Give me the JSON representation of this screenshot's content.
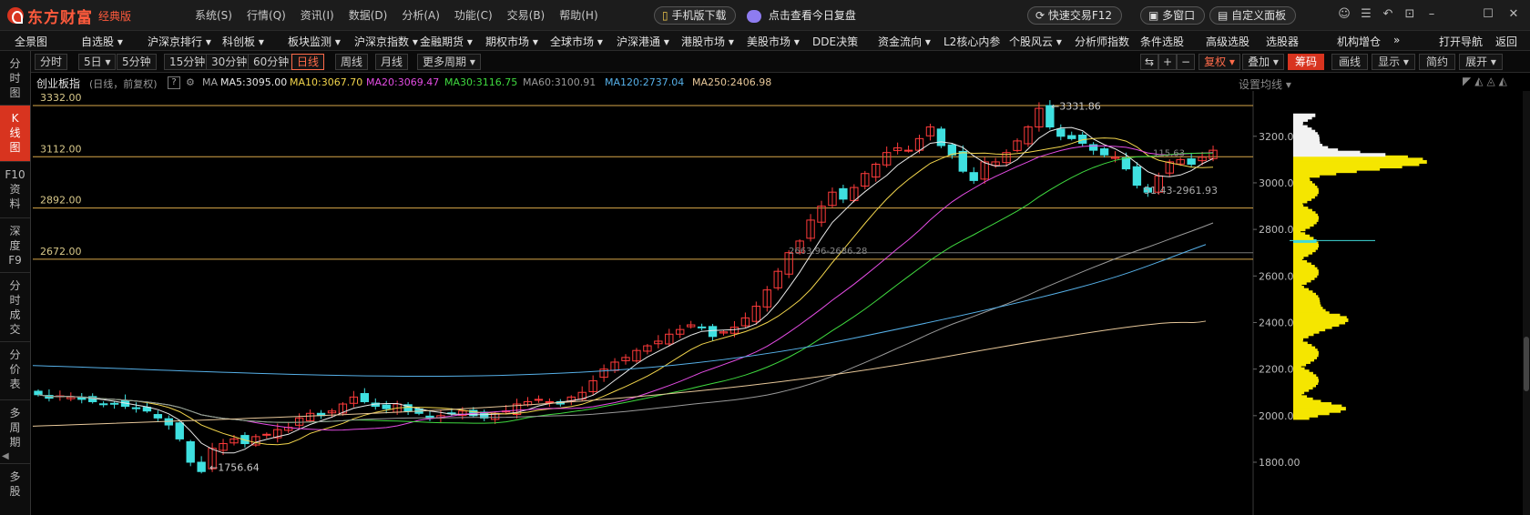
{
  "app": {
    "brand": "东方财富",
    "edition": "经典版"
  },
  "menu": [
    "系统(S)",
    "行情(Q)",
    "资讯(I)",
    "数据(D)",
    "分析(A)",
    "功能(C)",
    "交易(B)",
    "帮助(H)"
  ],
  "titlebar": {
    "mobile_download": "手机版下载",
    "review_today": "点击查看今日复盘",
    "quick_trade": "快速交易F12",
    "multi_window": "多窗口",
    "custom_panel": "自定义面板"
  },
  "nav": [
    "全景图",
    "自选股 ▾",
    "沪深京排行 ▾",
    "科创板 ▾",
    "板块监测 ▾",
    "沪深京指数 ▾",
    "金融期货 ▾",
    "期权市场 ▾",
    "全球市场 ▾",
    "沪深港通 ▾",
    "港股市场 ▾",
    "美股市场 ▾",
    "DDE决策",
    "资金流向 ▾",
    "L2核心内参",
    "个股风云 ▾",
    "分析师指数",
    "条件选股",
    "高级选股",
    "选股器",
    "机构增仓",
    "»",
    "打开导航",
    "返回"
  ],
  "sidebar": [
    "分\n时\n图",
    "K\n线\n图",
    "F10\n资\n料",
    "深\n度\nF9",
    "分\n时\n成\n交",
    "分\n价\n表",
    "多\n周\n期",
    "多\n股"
  ],
  "sidebar_active": 1,
  "periods": [
    "分时",
    "5日 ▾",
    "5分钟",
    "15分钟",
    "30分钟",
    "60分钟",
    "日线",
    "周线",
    "月线",
    "更多周期 ▾"
  ],
  "period_active": "日线",
  "right_tools": {
    "fuquan": "复权 ▾",
    "diejia": "叠加 ▾",
    "chouma": "筹码",
    "huaxian": "画线",
    "xianshi": "显示 ▾",
    "jianyue": "简约",
    "zhankai": "展开 ▾"
  },
  "info": {
    "name": "创业板指",
    "sub": "(日线，前复权)",
    "ma_label": "MA",
    "ma5": "MA5:3095.00",
    "ma10": "MA10:3067.70",
    "ma20": "MA20:3069.47",
    "ma30": "MA30:3116.75",
    "ma60": "MA60:3100.91",
    "ma120": "MA120:2737.04",
    "ma250": "MA250:2406.98",
    "set_ma": "设置均线 ▾",
    "colors": {
      "ma5": "#e8e8e8",
      "ma10": "#f2d54c",
      "ma20": "#e44ce4",
      "ma30": "#3fd93f",
      "ma60": "#9a9a9a",
      "ma120": "#56b0e8",
      "ma250": "#e8c89a"
    }
  },
  "levels": [
    "3332.00",
    "3112.00",
    "2892.00",
    "2672.00"
  ],
  "y_ticks": [
    "3200.00",
    "3000.00",
    "2800.00",
    "2600.00",
    "2400.00",
    "2200.00",
    "2000.00",
    "1800.00"
  ],
  "annotations": {
    "high": "3331.86",
    "low": "1756.64",
    "range1": "51.43-2961.93",
    "range2": "2663.96-2686.28",
    "small": "115.63"
  },
  "chart_data": {
    "type": "candlestick",
    "title": "创业板指",
    "ylim": [
      1800,
      3332
    ],
    "grid": false,
    "y_ticks": [
      3200,
      3000,
      2800,
      2600,
      2400,
      2200,
      2000,
      1800
    ],
    "price_levels": [
      3332,
      3112,
      2892,
      2672
    ],
    "high": 3331.86,
    "low": 1756.64,
    "close_series": [
      2090,
      2075,
      2085,
      2080,
      2070,
      2060,
      2050,
      2050,
      2040,
      2030,
      2020,
      1990,
      1960,
      1900,
      1800,
      1760,
      1860,
      1880,
      1900,
      1880,
      1910,
      1920,
      1940,
      1950,
      1990,
      2010,
      2000,
      2020,
      2050,
      2080,
      2060,
      2040,
      2030,
      2050,
      2020,
      2010,
      1990,
      2000,
      2010,
      2020,
      2000,
      1990,
      2010,
      2020,
      2050,
      2060,
      2070,
      2060,
      2050,
      2080,
      2100,
      2150,
      2200,
      2230,
      2250,
      2280,
      2300,
      2320,
      2350,
      2370,
      2390,
      2380,
      2340,
      2360,
      2380,
      2420,
      2470,
      2540,
      2620,
      2700,
      2750,
      2840,
      2900,
      2960,
      2930,
      2980,
      3040,
      3080,
      3130,
      3150,
      3140,
      3190,
      3240,
      3160,
      3120,
      3050,
      3010,
      3090,
      3090,
      3130,
      3180,
      3240,
      3320,
      3240,
      3200,
      3190,
      3170,
      3140,
      3120,
      3110,
      3060,
      2990,
      2960,
      3030,
      3090,
      3100,
      3080,
      3110,
      3140
    ],
    "volume_profile_peak_price": 3093
  }
}
